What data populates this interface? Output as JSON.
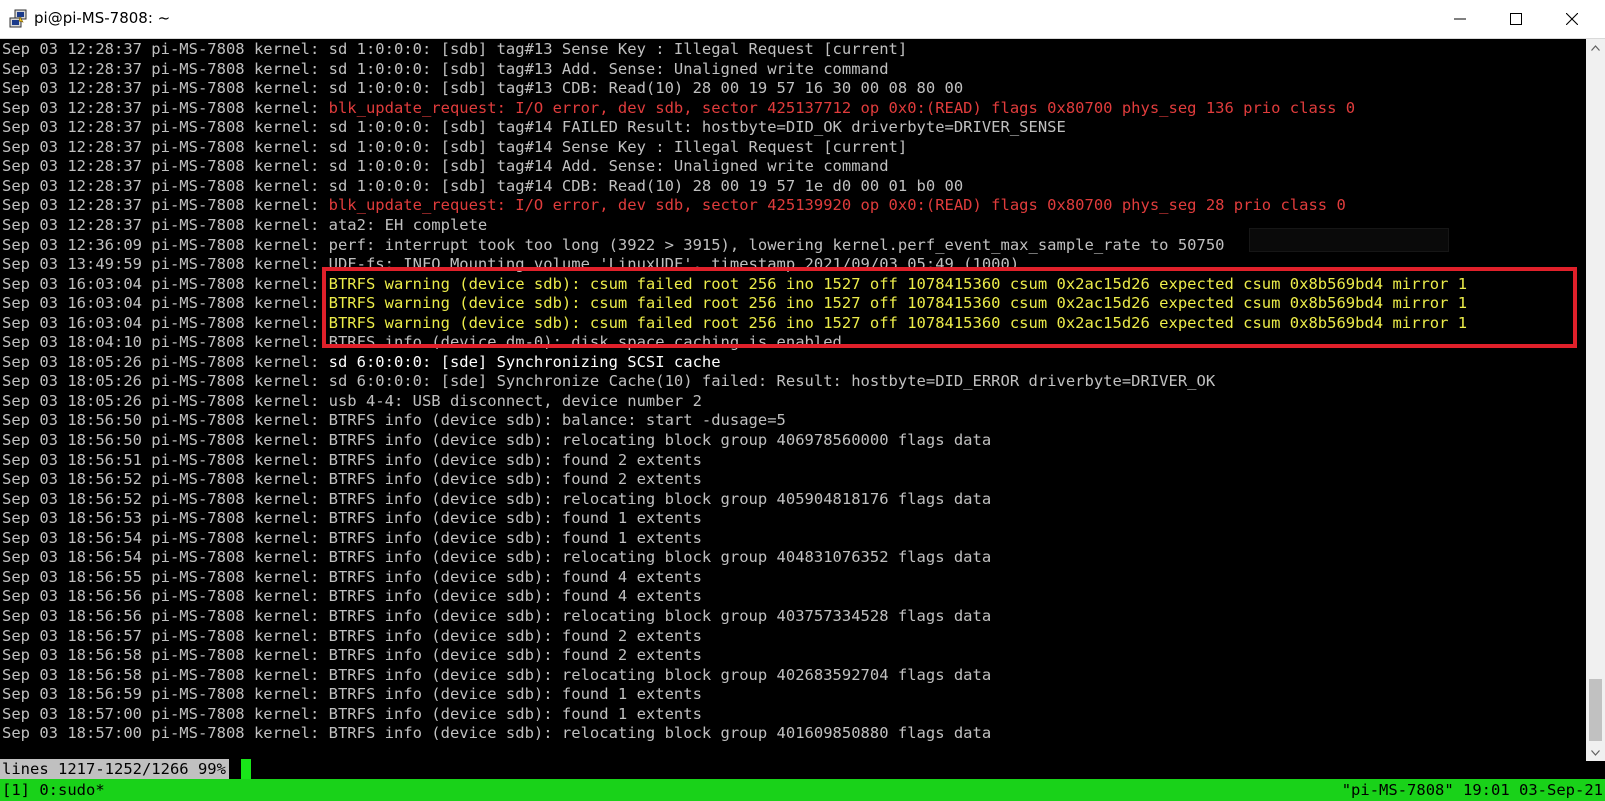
{
  "window": {
    "title": "pi@pi-MS-7808: ~",
    "icons": {
      "app": "putty-icon",
      "minimize": "minimize-icon",
      "maximize": "maximize-icon",
      "close": "close-icon"
    }
  },
  "terminal": {
    "lines": [
      {
        "prefix": "Sep 03 12:28:37 pi-MS-7808 kernel: ",
        "message": "sd 1:0:0:0: [sdb] tag#13 Sense Key : Illegal Request [current]",
        "level": "normal"
      },
      {
        "prefix": "Sep 03 12:28:37 pi-MS-7808 kernel: ",
        "message": "sd 1:0:0:0: [sdb] tag#13 Add. Sense: Unaligned write command",
        "level": "normal"
      },
      {
        "prefix": "Sep 03 12:28:37 pi-MS-7808 kernel: ",
        "message": "sd 1:0:0:0: [sdb] tag#13 CDB: Read(10) 28 00 19 57 16 30 00 08 80 00",
        "level": "normal"
      },
      {
        "prefix": "Sep 03 12:28:37 pi-MS-7808 kernel: ",
        "message": "blk_update_request: I/O error, dev sdb, sector 425137712 op 0x0:(READ) flags 0x80700 phys_seg 136 prio class 0",
        "level": "error"
      },
      {
        "prefix": "Sep 03 12:28:37 pi-MS-7808 kernel: ",
        "message": "sd 1:0:0:0: [sdb] tag#14 FAILED Result: hostbyte=DID_OK driverbyte=DRIVER_SENSE",
        "level": "normal"
      },
      {
        "prefix": "Sep 03 12:28:37 pi-MS-7808 kernel: ",
        "message": "sd 1:0:0:0: [sdb] tag#14 Sense Key : Illegal Request [current]",
        "level": "normal"
      },
      {
        "prefix": "Sep 03 12:28:37 pi-MS-7808 kernel: ",
        "message": "sd 1:0:0:0: [sdb] tag#14 Add. Sense: Unaligned write command",
        "level": "normal"
      },
      {
        "prefix": "Sep 03 12:28:37 pi-MS-7808 kernel: ",
        "message": "sd 1:0:0:0: [sdb] tag#14 CDB: Read(10) 28 00 19 57 1e d0 00 01 b0 00",
        "level": "normal"
      },
      {
        "prefix": "Sep 03 12:28:37 pi-MS-7808 kernel: ",
        "message": "blk_update_request: I/O error, dev sdb, sector 425139920 op 0x0:(READ) flags 0x80700 phys_seg 28 prio class 0",
        "level": "error"
      },
      {
        "prefix": "Sep 03 12:28:37 pi-MS-7808 kernel: ",
        "message": "ata2: EH complete",
        "level": "normal"
      },
      {
        "prefix": "Sep 03 12:36:09 pi-MS-7808 kernel: ",
        "message": "perf: interrupt took too long (3922 > 3915), lowering kernel.perf_event_max_sample_rate to 50750",
        "level": "normal"
      },
      {
        "prefix": "Sep 03 13:49:59 pi-MS-7808 kernel: ",
        "message": "UDF-fs: INFO Mounting volume 'LinuxUDF', timestamp 2021/09/03 05:49 (1000)",
        "level": "normal"
      },
      {
        "prefix": "Sep 03 16:03:04 pi-MS-7808 kernel: ",
        "message": "BTRFS warning (device sdb): csum failed root 256 ino 1527 off 1078415360 csum 0x2ac15d26 expected csum 0x8b569bd4 mirror 1",
        "level": "warning"
      },
      {
        "prefix": "Sep 03 16:03:04 pi-MS-7808 kernel: ",
        "message": "BTRFS warning (device sdb): csum failed root 256 ino 1527 off 1078415360 csum 0x2ac15d26 expected csum 0x8b569bd4 mirror 1",
        "level": "warning"
      },
      {
        "prefix": "Sep 03 16:03:04 pi-MS-7808 kernel: ",
        "message": "BTRFS warning (device sdb): csum failed root 256 ino 1527 off 1078415360 csum 0x2ac15d26 expected csum 0x8b569bd4 mirror 1",
        "level": "warning"
      },
      {
        "prefix": "Sep 03 18:04:10 pi-MS-7808 kernel: ",
        "message": "BTRFS info (device dm-0): disk space caching is enabled",
        "level": "normal"
      },
      {
        "prefix": "Sep 03 18:05:26 pi-MS-7808 kernel: ",
        "message": "sd 6:0:0:0: [sde] Synchronizing SCSI cache",
        "level": "bright"
      },
      {
        "prefix": "Sep 03 18:05:26 pi-MS-7808 kernel: ",
        "message": "sd 6:0:0:0: [sde] Synchronize Cache(10) failed: Result: hostbyte=DID_ERROR driverbyte=DRIVER_OK",
        "level": "normal"
      },
      {
        "prefix": "Sep 03 18:05:26 pi-MS-7808 kernel: ",
        "message": "usb 4-4: USB disconnect, device number 2",
        "level": "normal"
      },
      {
        "prefix": "Sep 03 18:56:50 pi-MS-7808 kernel: ",
        "message": "BTRFS info (device sdb): balance: start -dusage=5",
        "level": "normal"
      },
      {
        "prefix": "Sep 03 18:56:50 pi-MS-7808 kernel: ",
        "message": "BTRFS info (device sdb): relocating block group 406978560000 flags data",
        "level": "normal"
      },
      {
        "prefix": "Sep 03 18:56:51 pi-MS-7808 kernel: ",
        "message": "BTRFS info (device sdb): found 2 extents",
        "level": "normal"
      },
      {
        "prefix": "Sep 03 18:56:52 pi-MS-7808 kernel: ",
        "message": "BTRFS info (device sdb): found 2 extents",
        "level": "normal"
      },
      {
        "prefix": "Sep 03 18:56:52 pi-MS-7808 kernel: ",
        "message": "BTRFS info (device sdb): relocating block group 405904818176 flags data",
        "level": "normal"
      },
      {
        "prefix": "Sep 03 18:56:53 pi-MS-7808 kernel: ",
        "message": "BTRFS info (device sdb): found 1 extents",
        "level": "normal"
      },
      {
        "prefix": "Sep 03 18:56:54 pi-MS-7808 kernel: ",
        "message": "BTRFS info (device sdb): found 1 extents",
        "level": "normal"
      },
      {
        "prefix": "Sep 03 18:56:54 pi-MS-7808 kernel: ",
        "message": "BTRFS info (device sdb): relocating block group 404831076352 flags data",
        "level": "normal"
      },
      {
        "prefix": "Sep 03 18:56:55 pi-MS-7808 kernel: ",
        "message": "BTRFS info (device sdb): found 4 extents",
        "level": "normal"
      },
      {
        "prefix": "Sep 03 18:56:56 pi-MS-7808 kernel: ",
        "message": "BTRFS info (device sdb): found 4 extents",
        "level": "normal"
      },
      {
        "prefix": "Sep 03 18:56:56 pi-MS-7808 kernel: ",
        "message": "BTRFS info (device sdb): relocating block group 403757334528 flags data",
        "level": "normal"
      },
      {
        "prefix": "Sep 03 18:56:57 pi-MS-7808 kernel: ",
        "message": "BTRFS info (device sdb): found 2 extents",
        "level": "normal"
      },
      {
        "prefix": "Sep 03 18:56:58 pi-MS-7808 kernel: ",
        "message": "BTRFS info (device sdb): found 2 extents",
        "level": "normal"
      },
      {
        "prefix": "Sep 03 18:56:58 pi-MS-7808 kernel: ",
        "message": "BTRFS info (device sdb): relocating block group 402683592704 flags data",
        "level": "normal"
      },
      {
        "prefix": "Sep 03 18:56:59 pi-MS-7808 kernel: ",
        "message": "BTRFS info (device sdb): found 1 extents",
        "level": "normal"
      },
      {
        "prefix": "Sep 03 18:57:00 pi-MS-7808 kernel: ",
        "message": "BTRFS info (device sdb): found 1 extents",
        "level": "normal"
      },
      {
        "prefix": "Sep 03 18:57:00 pi-MS-7808 kernel: ",
        "message": "BTRFS info (device sdb): relocating block group 401609850880 flags data",
        "level": "normal"
      }
    ],
    "pager_status": "lines 1217-1252/1266 99%"
  },
  "tmux": {
    "window_list": "[1] 0:sudo*",
    "status_right": "\"pi-MS-7808\" 19:01 03-Sep-21"
  },
  "colors": {
    "terminal_bg": "#000000",
    "text_normal": "#c0c0c0",
    "text_error": "#e03c3c",
    "text_warning": "#ecec4a",
    "highlight_box": "#e0202a",
    "tmux_status_bg": "#19d219"
  }
}
